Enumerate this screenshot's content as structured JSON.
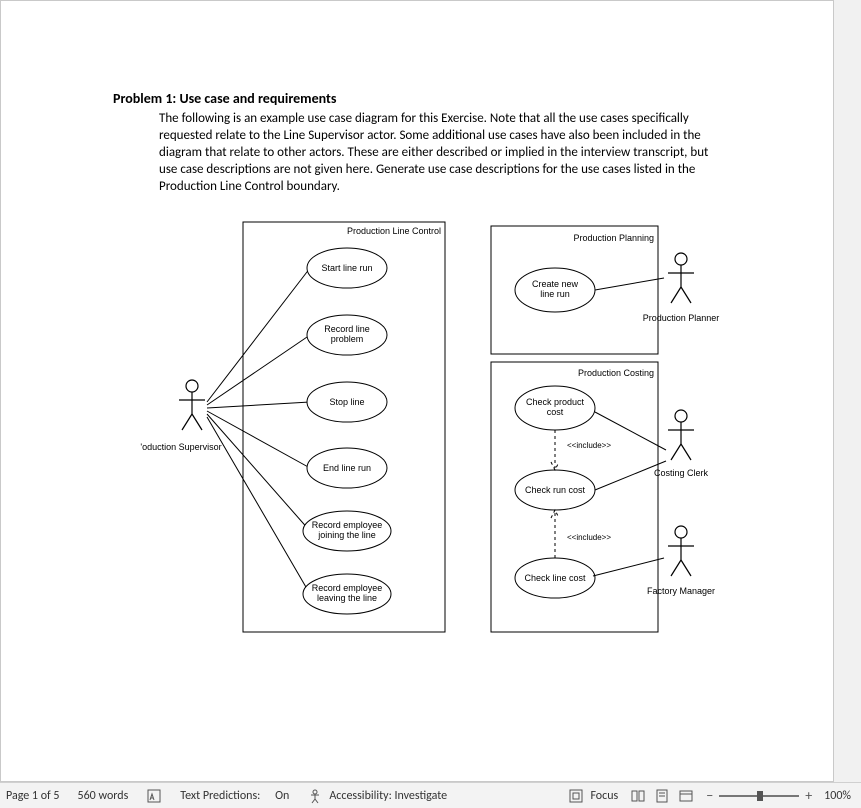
{
  "document": {
    "title": "Problem 1: Use case and requirements",
    "paragraph": "The following is an example use case diagram for this Exercise. Note that all the use cases specifically requested relate to the Line Supervisor actor. Some additional use cases have also been included in the diagram that relate to other actors. These are either described or implied in the interview transcript, but use case descriptions are not given here. Generate use case descriptions for the use cases listed in the Production Line Control boundary."
  },
  "diagram": {
    "boundaries": {
      "line_control": "Production Line Control",
      "planning": "Production Planning",
      "costing": "Production Costing"
    },
    "use_cases": {
      "start_line_run": "Start line run",
      "record_line_problem_l1": "Record line",
      "record_line_problem_l2": "problem",
      "stop_line": "Stop line",
      "end_line_run": "End line run",
      "record_join_l1": "Record employee",
      "record_join_l2": "joining the line",
      "record_leave_l1": "Record employee",
      "record_leave_l2": "leaving the line",
      "create_run_l1": "Create new",
      "create_run_l2": "line run",
      "check_product_cost_l1": "Check product",
      "check_product_cost_l2": "cost",
      "check_run_cost": "Check run cost",
      "check_line_cost": "Check line cost"
    },
    "stereotypes": {
      "include1": "<<include>>",
      "include2": "<<include>>"
    },
    "actors": {
      "supervisor": "'oduction Supervisor",
      "planner": "Production Planner",
      "costing_clerk": "Costing Clerk",
      "factory_manager": "Factory Manager"
    }
  },
  "status": {
    "page": "Page 1 of 5",
    "words": "560 words",
    "predictions_label": "Text Predictions:",
    "predictions_value": "On",
    "accessibility": "Accessibility: Investigate",
    "focus": "Focus",
    "zoom": "100%"
  }
}
